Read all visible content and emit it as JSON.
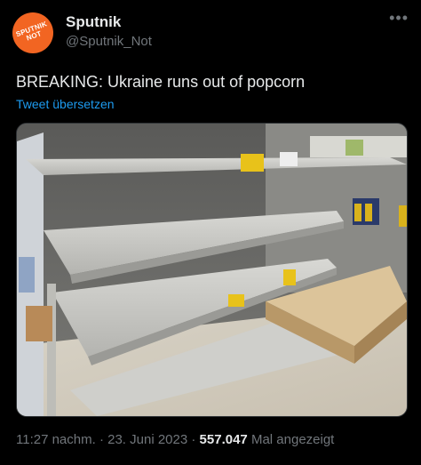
{
  "tweet": {
    "display_name": "Sputnik",
    "handle": "@Sputnik_Not",
    "avatar_text": "SPUTNIK NOT",
    "more_icon": "ellipsis-icon",
    "text": "BREAKING: Ukraine runs out of popcorn",
    "translate_label": "Tweet übersetzen",
    "time": "11:27 nachm.",
    "separator": "·",
    "date": "23. Juni 2023",
    "views": "557.047",
    "views_label": "Mal angezeigt"
  },
  "colors": {
    "background": "#000000",
    "text": "#e7e9ea",
    "muted": "#71767b",
    "link": "#1d9bf0",
    "avatar": "#f26522"
  }
}
